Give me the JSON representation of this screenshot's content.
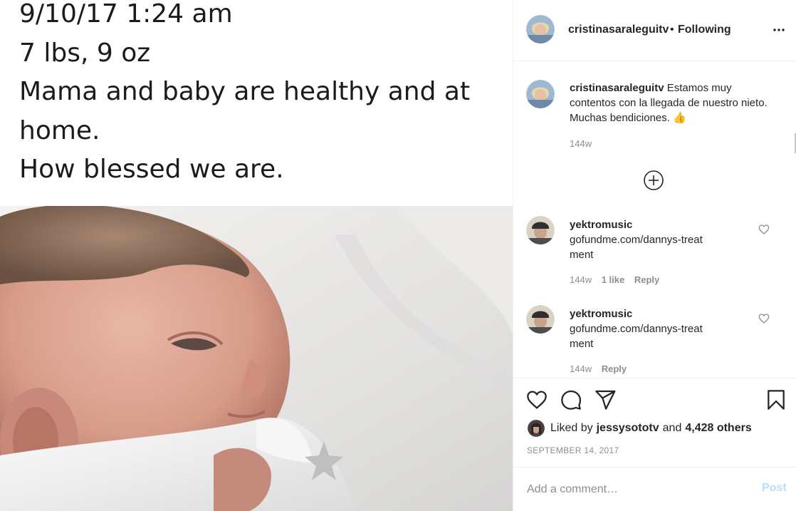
{
  "post_media": {
    "caption_lines": [
      "9/10/17 1:24 am",
      "7 lbs, 9 oz",
      "Mama and baby are healthy and at",
      "home.",
      "How blessed we are."
    ]
  },
  "header": {
    "username": "cristinasaraleguitv",
    "separator": "•",
    "follow_status": "Following",
    "more_icon": "ellipsis-icon"
  },
  "caption": {
    "username": "cristinasaraleguitv",
    "text": "Estamos muy contentos con la llegada de nuestro nieto. Muchas bendiciones. 👍",
    "time": "144w"
  },
  "load_more_icon": "plus-circle-icon",
  "comments": [
    {
      "username": "yektromusic",
      "text": "gofundme.com/dannys-treatment",
      "time": "144w",
      "likes": "1 like",
      "reply": "Reply"
    },
    {
      "username": "yektromusic",
      "text": "gofundme.com/dannys-treatment",
      "time": "144w",
      "likes": "",
      "reply": "Reply"
    }
  ],
  "actions": {
    "like_icon": "heart-icon",
    "comment_icon": "comment-icon",
    "share_icon": "paper-plane-icon",
    "save_icon": "bookmark-icon"
  },
  "likes": {
    "prefix": "Liked by",
    "user": "jessysototv",
    "and": "and",
    "others": "4,428 others"
  },
  "date": "SEPTEMBER 14, 2017",
  "comment_box": {
    "placeholder": "Add a comment…",
    "post_label": "Post"
  },
  "colors": {
    "text": "#262626",
    "muted": "#8e8e8e",
    "border": "#efefef",
    "post_disabled": "#b2dffc"
  }
}
